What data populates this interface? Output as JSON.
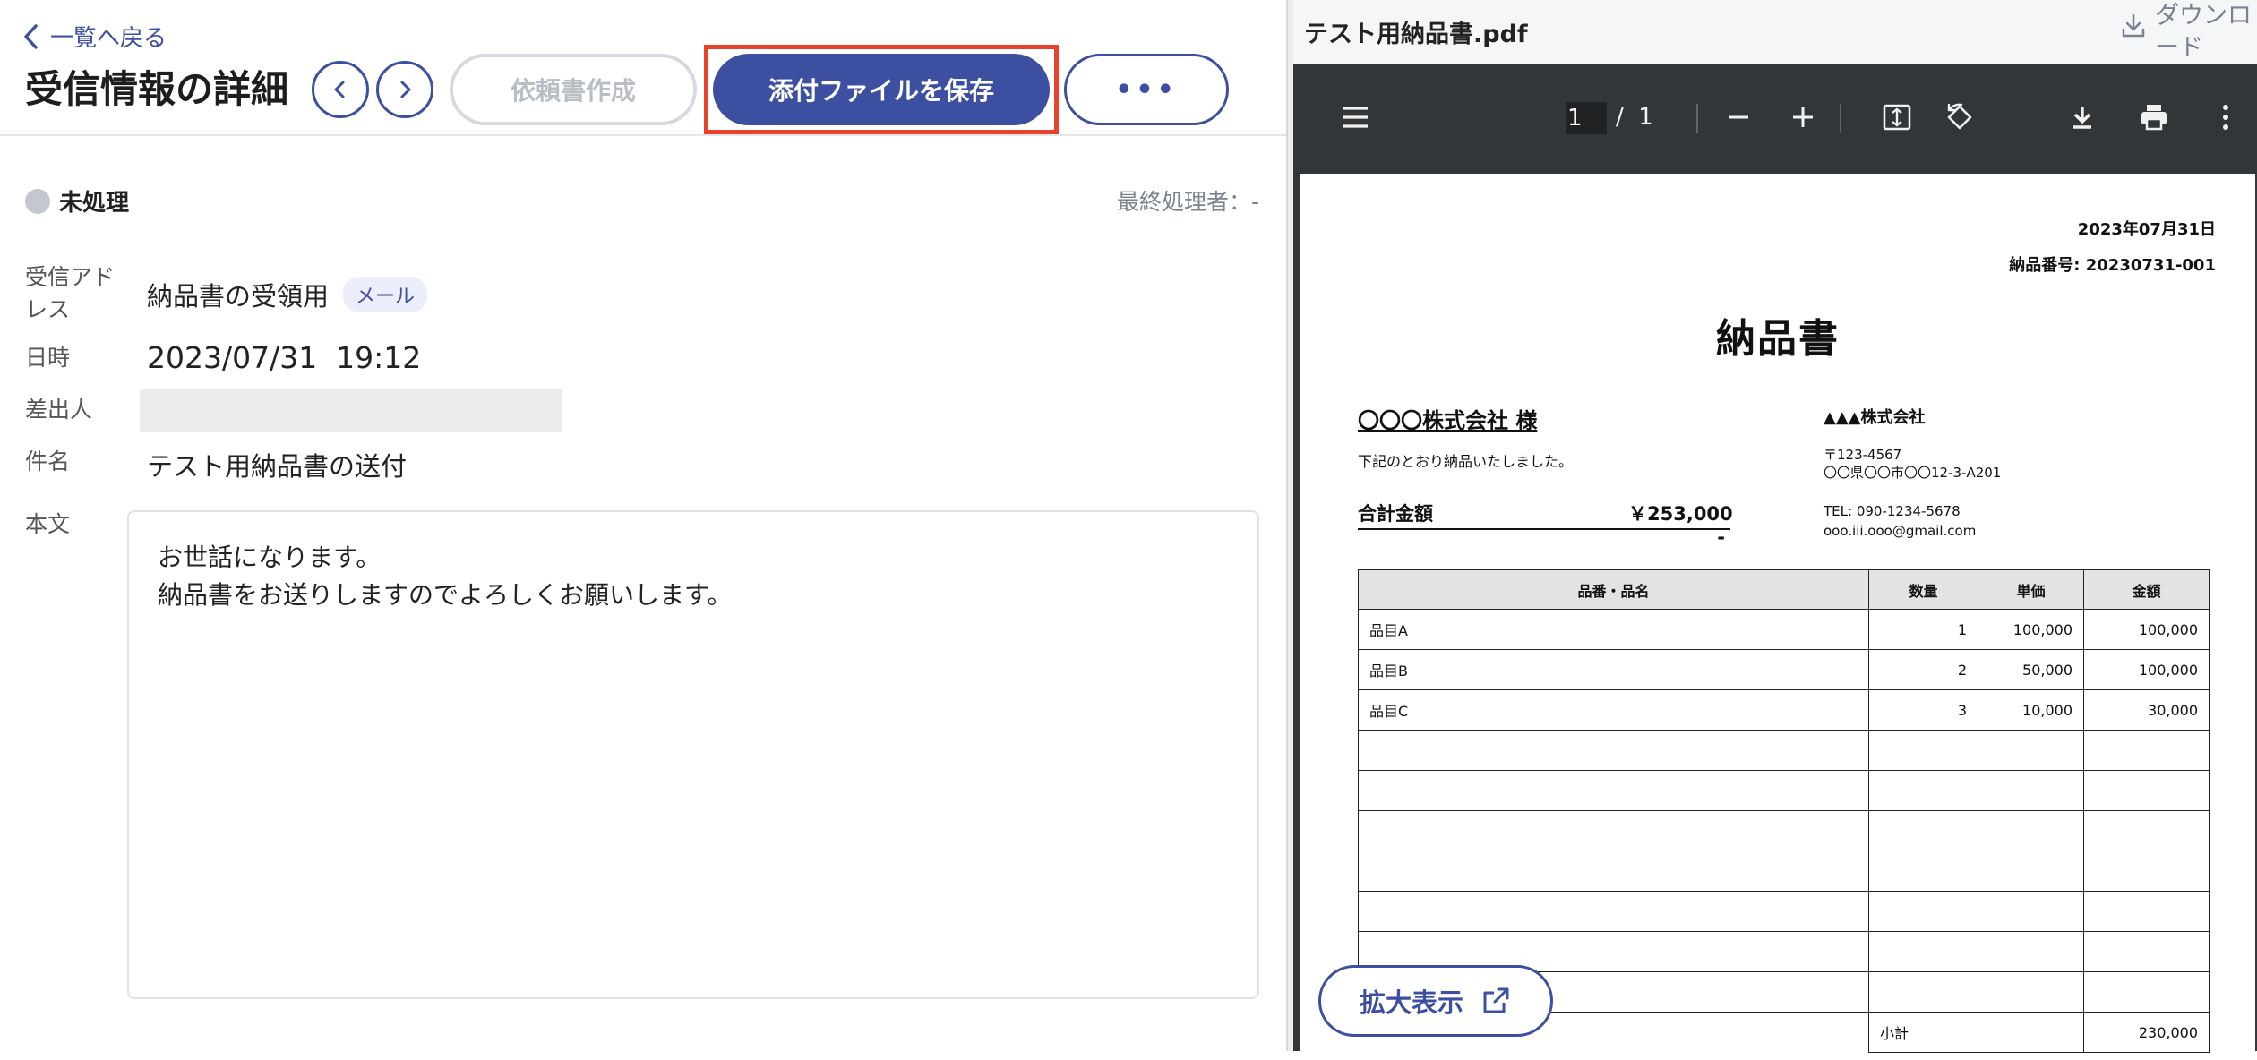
{
  "left": {
    "back_label": "一覧へ戻る",
    "title": "受信情報の詳細",
    "buttons": {
      "request": "依頼書作成",
      "save": "添付ファイルを保存",
      "more": "•••"
    },
    "status": "未処理",
    "last_handler": "最終処理者：-",
    "fields": {
      "address_label": "受信アドレス",
      "address_value": "納品書の受領用",
      "address_badge": "メール",
      "date_label": "日時",
      "date_value": "2023/07/31  19:12",
      "sender_label": "差出人",
      "subject_label": "件名",
      "subject_value": "テスト用納品書の送付",
      "body_label": "本文",
      "body_lines": [
        "お世話になります。",
        "納品書をお送りしますのでよろしくお願いします。"
      ]
    },
    "expand_label": "拡大表示"
  },
  "viewer": {
    "file_name": "テスト用納品書.pdf",
    "download_label": "ダウンロード",
    "page_current": "1",
    "page_total": "/  1"
  },
  "pdf": {
    "date": "2023年07月31日",
    "number": "納品番号: 20230731-001",
    "title": "納品書",
    "recipient": "〇〇〇株式会社 様",
    "note": "下記のとおり納品いたしました。",
    "total_label": "合計金額",
    "total_value": "￥253,000 -",
    "company": "▲▲▲株式会社",
    "postal": "〒123-4567",
    "address": "〇〇県〇〇市〇〇12-3-A201",
    "tel": "TEL: 090-1234-5678",
    "email": "ooo.iii.ooo@gmail.com",
    "headers": [
      "品番・品名",
      "数量",
      "単価",
      "金額"
    ],
    "rows": [
      [
        "品目A",
        "1",
        "100,000",
        "100,000"
      ],
      [
        "品目B",
        "2",
        "50,000",
        "100,000"
      ],
      [
        "品目C",
        "3",
        "10,000",
        "30,000"
      ]
    ],
    "subtotal_label": "小計",
    "subtotal_value": "230,000"
  },
  "colors": {
    "brand": "#3d4fa0",
    "highlight": "#e8412c",
    "toolbar": "#323639"
  }
}
